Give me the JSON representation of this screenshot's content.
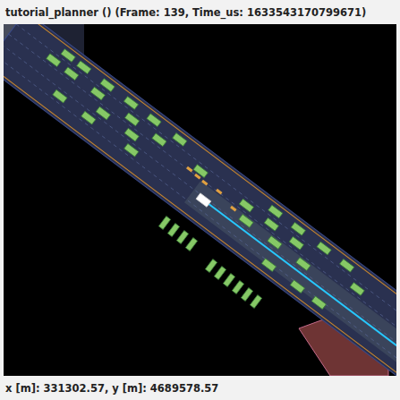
{
  "window": {
    "title": "tutorial_planner () (Frame: 139, Time_us: 1633543170799671)"
  },
  "status_bar": {
    "text": "x [m]: 331302.57, y [m]: 4689578.57"
  }
}
